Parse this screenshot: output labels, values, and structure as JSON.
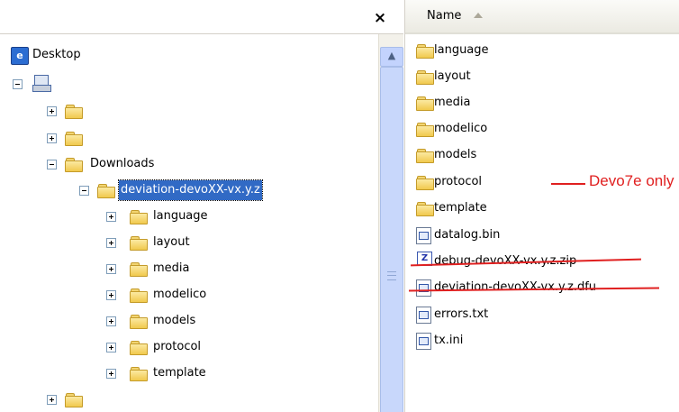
{
  "tree": {
    "close_symbol": "×",
    "desktop_label": "Desktop",
    "downloads_label": "Downloads",
    "selected_folder": "deviation-devoXX-vx.y.z",
    "subfolders": [
      "language",
      "layout",
      "media",
      "modelico",
      "models",
      "protocol",
      "template"
    ]
  },
  "list": {
    "column_name": "Name",
    "sort": "ascending",
    "folders": [
      "language",
      "layout",
      "media",
      "modelico",
      "models",
      "protocol",
      "template"
    ],
    "files": [
      {
        "name": "datalog.bin",
        "icon": "binary-file-icon",
        "struck": false
      },
      {
        "name": "debug-devoXX-vx.y.z.zip",
        "icon": "zip-file-icon",
        "struck": true
      },
      {
        "name": "deviation-devoXX-vx.y.z.dfu",
        "icon": "binary-file-icon",
        "struck": true
      },
      {
        "name": "errors.txt",
        "icon": "text-file-icon",
        "struck": false
      },
      {
        "name": "tx.ini",
        "icon": "ini-file-icon",
        "struck": false
      }
    ]
  },
  "annotation": {
    "text": "Devo7e only",
    "color": "#e02020"
  },
  "colors": {
    "selection": "#316ac5",
    "folder": "#f1c94d",
    "strike": "#e02020"
  }
}
